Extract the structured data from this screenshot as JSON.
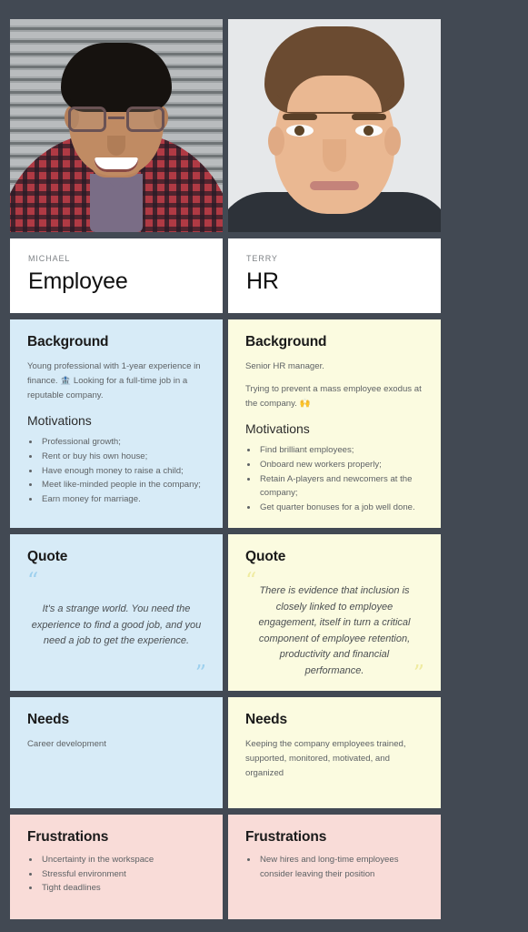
{
  "background_color": "#424953",
  "personas": [
    {
      "id": "michael",
      "photo_alt": "smiling man with glasses in red plaid shirt",
      "name": "MICHAEL",
      "role": "Employee",
      "accent_color": "#d7ebf7",
      "background": {
        "heading": "Background",
        "paragraphs": [
          "Young professional with 1-year experience in finance. 🏦 Looking for a full-time job in a reputable company."
        ],
        "subheading": "Motivations",
        "motivations": [
          "Professional growth;",
          "Rent or buy his own house;",
          "Have enough money to raise a child;",
          "Meet like-minded people in the company;",
          "Earn money for marriage."
        ]
      },
      "quote": {
        "heading": "Quote",
        "open_mark": "“",
        "close_mark": "”",
        "text": "It's a strange world. You need the experience to find a good job, and you need a job to get the experience."
      },
      "needs": {
        "heading": "Needs",
        "text": "Career development"
      },
      "frustrations": {
        "heading": "Frustrations",
        "items": [
          "Uncertainty in the workspace",
          "Stressful environment",
          "Tight deadlines"
        ]
      }
    },
    {
      "id": "terry",
      "photo_alt": "man with brown hair on light gray background",
      "name": "TERRY",
      "role": "HR",
      "accent_color": "#fbfbe0",
      "background": {
        "heading": "Background",
        "paragraphs": [
          "Senior HR manager.",
          "Trying to prevent a mass employee exodus at the company. 🙌"
        ],
        "subheading": "Motivations",
        "motivations": [
          "Find brilliant employees;",
          "Onboard new workers properly;",
          "Retain A-players and newcomers at the company;",
          "Get quarter bonuses for a job well done."
        ]
      },
      "quote": {
        "heading": "Quote",
        "open_mark": "“",
        "close_mark": "”",
        "text": "There is evidence that inclusion is closely linked to employee engagement, itself in turn a critical component of employee retention, productivity and financial performance."
      },
      "needs": {
        "heading": "Needs",
        "text": "Keeping the company employees trained, supported, monitored, motivated, and organized"
      },
      "frustrations": {
        "heading": "Frustrations",
        "items": [
          "New hires and long-time employees consider leaving their position"
        ]
      }
    }
  ]
}
